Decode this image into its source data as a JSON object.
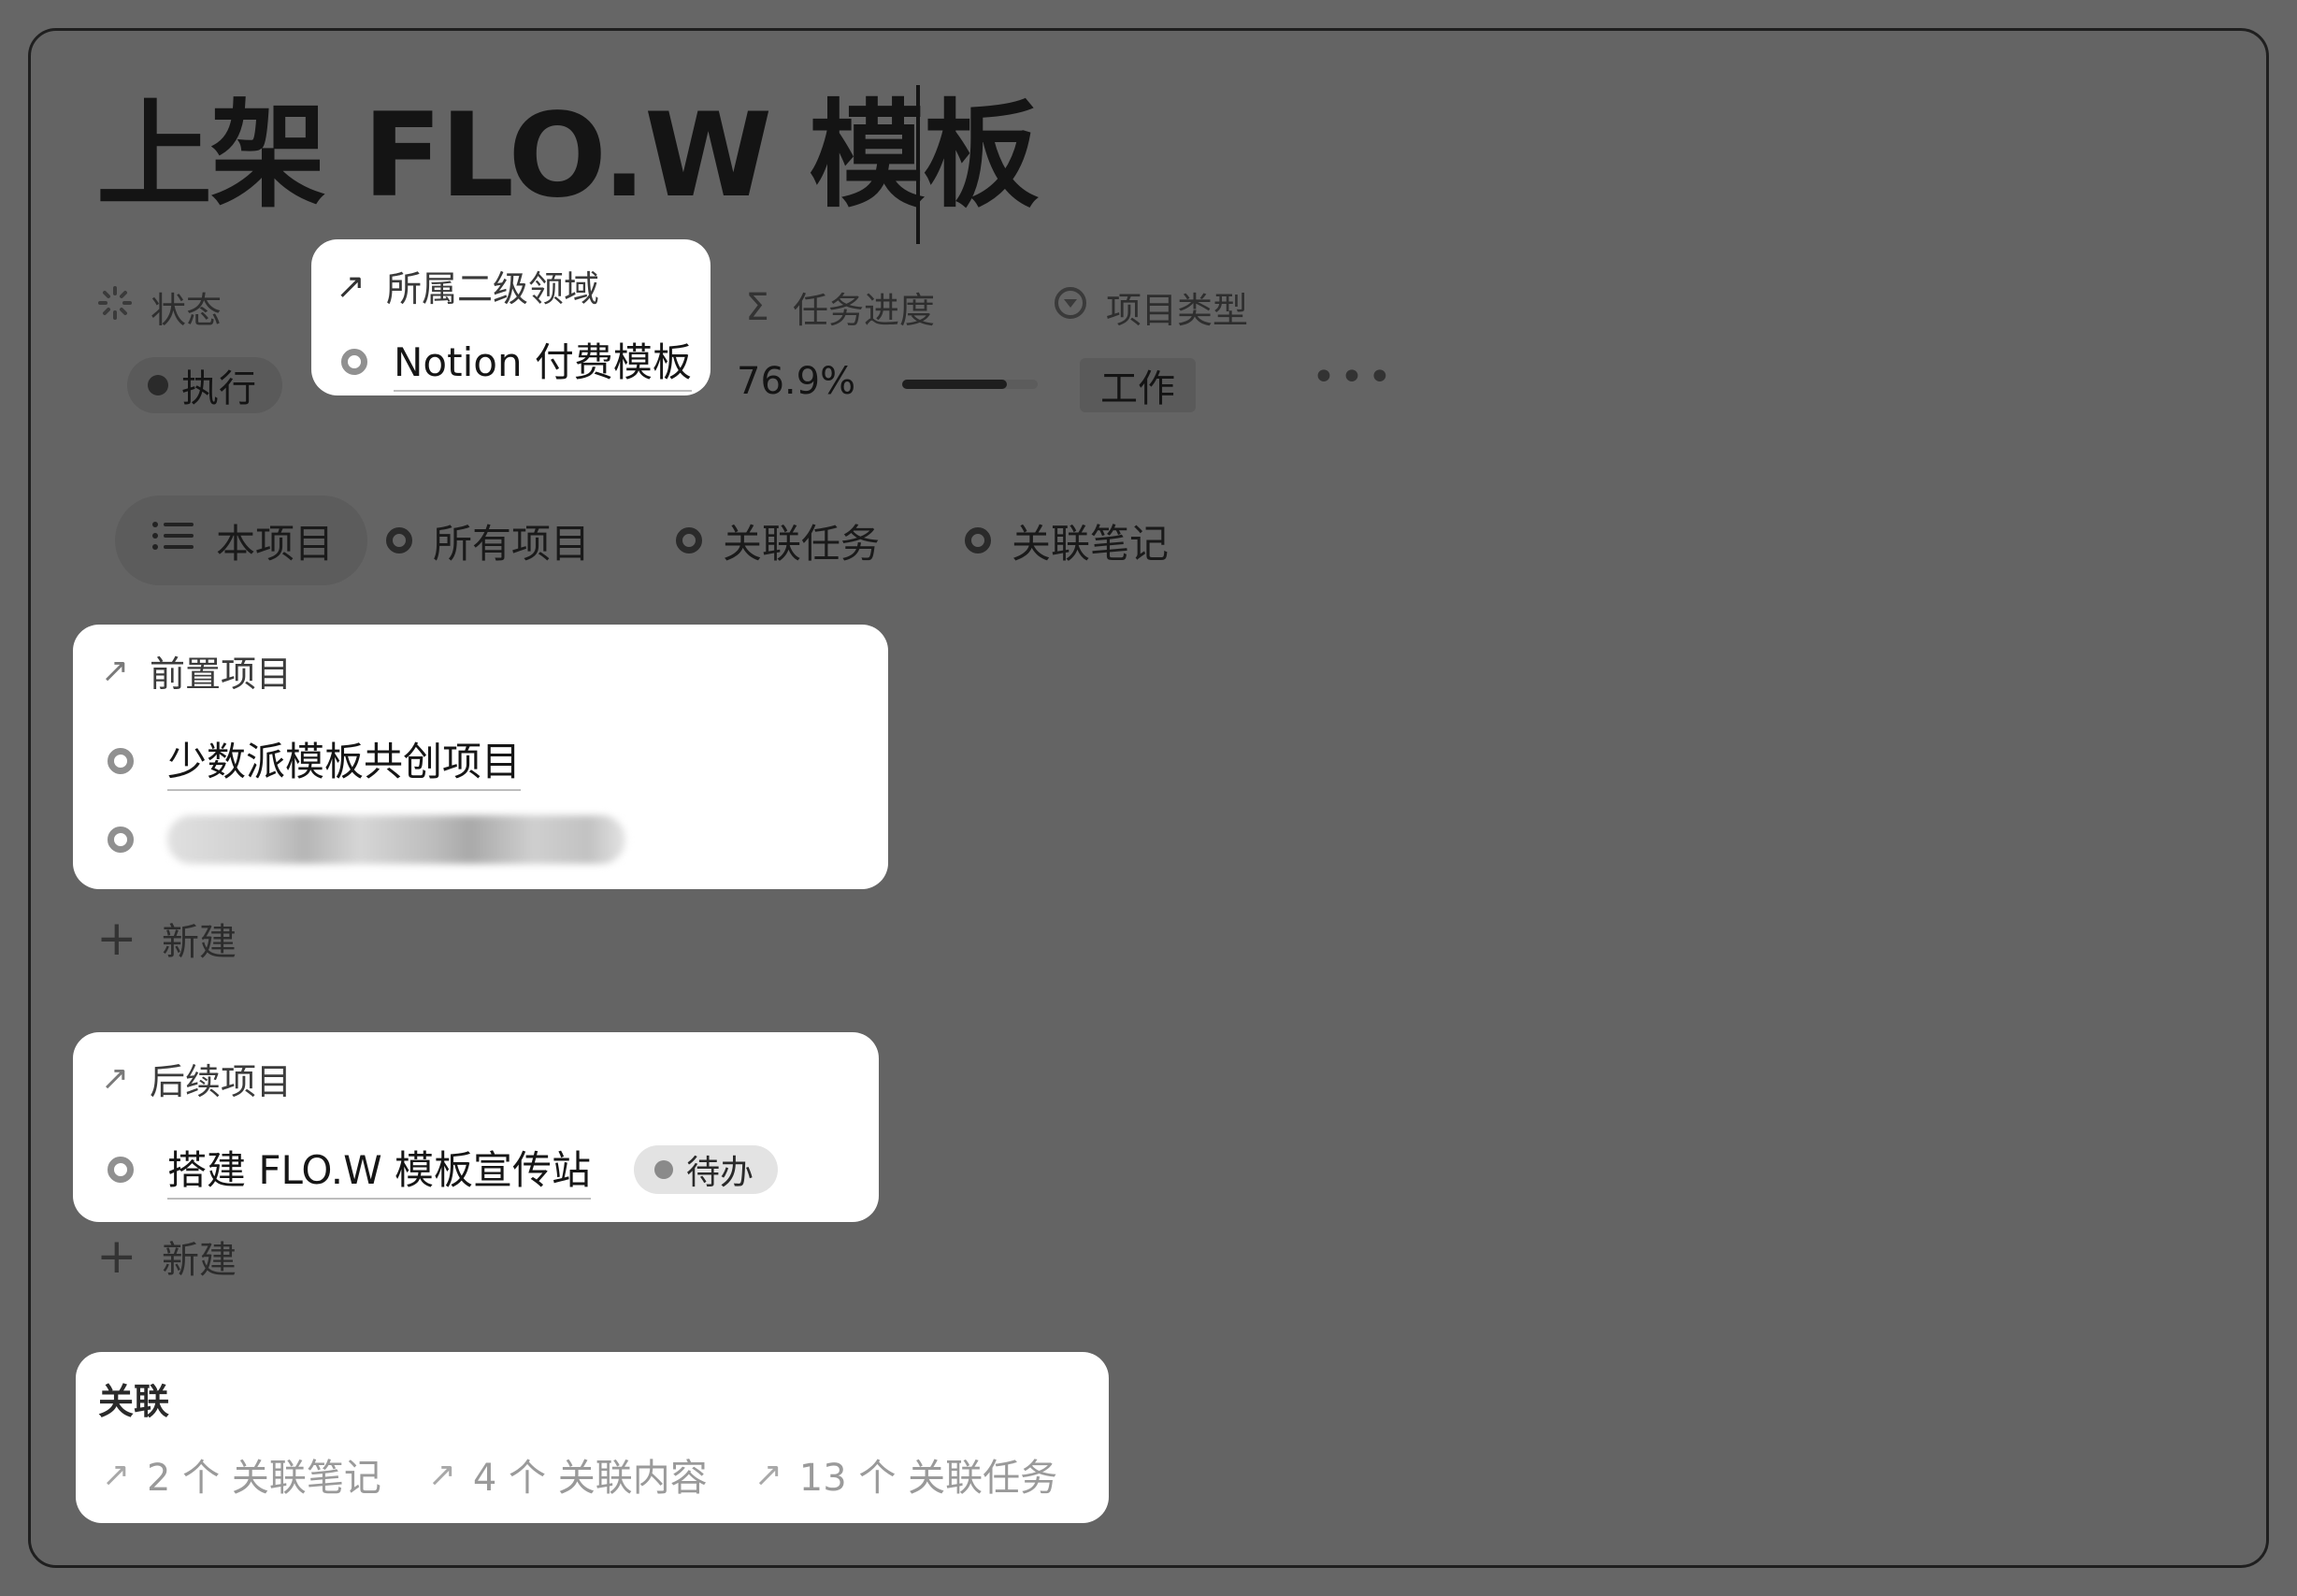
{
  "page": {
    "title": "上架 FLO.W 模板"
  },
  "properties": {
    "status": {
      "label": "状态",
      "icon": "loading-spinner-icon",
      "value": "执行"
    },
    "domain": {
      "label": "所属二级领域",
      "icon": "relation-arrow-icon",
      "value": "Notion 付费模板"
    },
    "progress": {
      "label": "任务进度",
      "icon": "sigma-icon",
      "value_text": "76.9%",
      "value": 0.769
    },
    "type": {
      "label": "项目类型",
      "icon": "select-icon",
      "value": "工作"
    },
    "more_icon": "more-icon"
  },
  "tabs": [
    {
      "label": "本项目",
      "icon": "list-icon",
      "active": true
    },
    {
      "label": "所有项目",
      "icon": "circle-icon",
      "active": false
    },
    {
      "label": "关联任务",
      "icon": "circle-icon",
      "active": false
    },
    {
      "label": "关联笔记",
      "icon": "circle-icon",
      "active": false
    }
  ],
  "predecessor": {
    "title": "前置项目",
    "items": [
      {
        "label": "少数派模板共创项目"
      }
    ],
    "new_label": "新建"
  },
  "successor": {
    "title": "后续项目",
    "items": [
      {
        "label": "搭建 FLO.W 模板宣传站",
        "status": "待办"
      }
    ],
    "new_label": "新建"
  },
  "relations": {
    "title": "关联",
    "links": [
      {
        "label": "2 个 关联笔记"
      },
      {
        "label": "4 个 关联内容"
      },
      {
        "label": "13 个 关联任务"
      }
    ]
  },
  "colors": {
    "overlay": "#666666",
    "card": "#ffffff",
    "text": "#141414"
  }
}
